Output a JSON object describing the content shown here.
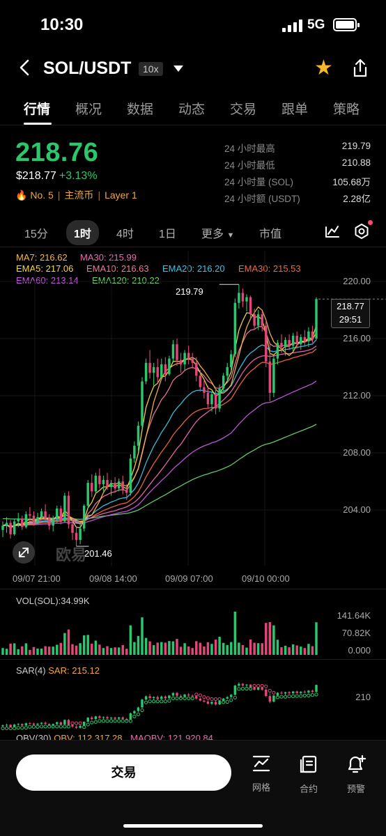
{
  "status_bar": {
    "time": "10:30",
    "network": "5G"
  },
  "header": {
    "pair": "SOL/USDT",
    "leverage": "10x"
  },
  "tabs": [
    "行情",
    "概况",
    "数据",
    "动态",
    "交易",
    "跟单",
    "策略"
  ],
  "ticker": {
    "last_price": "218.76",
    "usd_price": "$218.77",
    "change_pct": "+3.13%",
    "rank": "No. 5",
    "tag1": "主流币",
    "tag2": "Layer 1",
    "stats": [
      {
        "label": "24 小时最高",
        "value": "219.79"
      },
      {
        "label": "24 小时最低",
        "value": "210.88"
      },
      {
        "label": "24 小时量 (SOL)",
        "value": "105.68万"
      },
      {
        "label": "24 小时额 (USDT)",
        "value": "2.28亿"
      }
    ]
  },
  "intervals": {
    "i15": "15分",
    "i1h": "1时",
    "i4h": "4时",
    "i1d": "1日",
    "more": "更多",
    "mcap": "市值"
  },
  "indicators": {
    "ma7": "MA7: 216.62",
    "ma30": "MA30: 215.99",
    "ema5": "EMA5: 217.06",
    "ema10": "EMA10: 216.63",
    "ema20": "EMA20: 216.20",
    "ema30": "EMA30: 215.53",
    "ema60": "EMA60: 213.14",
    "ema120": "EMA120: 210.22"
  },
  "colors": {
    "up": "#2bc76e",
    "down": "#e0487a",
    "ma7": "#f5b84a",
    "ma30": "#ec6bb0",
    "ema5": "#f7d94c",
    "ema10": "#f07a9a",
    "ema20": "#3ec4e6",
    "ema30": "#f06a3a",
    "ema60": "#c55be0",
    "ema120": "#6cd36a"
  },
  "chart_data": {
    "type": "candlestick",
    "y_ticks": [
      "220.00",
      "216.00",
      "212.00",
      "208.00",
      "204.00"
    ],
    "ylim": [
      200.2,
      221.0
    ],
    "x_ticks": [
      "09/07 21:00",
      "09/08 14:00",
      "09/09 07:00",
      "09/10 00:00"
    ],
    "high_label": "219.79",
    "low_label": "201.46",
    "last_price_tag": "218.77",
    "countdown": "29:51",
    "ohlc": [
      [
        202.6,
        203.2,
        202.1,
        202.9
      ],
      [
        202.9,
        203.5,
        202.4,
        203.1
      ],
      [
        203.1,
        203.3,
        202.0,
        202.3
      ],
      [
        202.3,
        203.4,
        202.2,
        203.2
      ],
      [
        203.2,
        203.8,
        202.8,
        203.4
      ],
      [
        203.4,
        203.6,
        202.6,
        202.8
      ],
      [
        202.8,
        203.9,
        202.7,
        203.7
      ],
      [
        203.7,
        204.2,
        203.2,
        203.6
      ],
      [
        203.6,
        203.9,
        202.9,
        203.1
      ],
      [
        203.1,
        203.8,
        203.0,
        203.5
      ],
      [
        203.5,
        204.1,
        203.3,
        203.9
      ],
      [
        203.9,
        204.4,
        203.2,
        203.4
      ],
      [
        203.4,
        203.7,
        202.6,
        202.9
      ],
      [
        202.9,
        203.6,
        202.5,
        203.4
      ],
      [
        203.4,
        204.3,
        203.1,
        204.1
      ],
      [
        204.1,
        204.3,
        203.0,
        203.2
      ],
      [
        203.2,
        205.2,
        203.1,
        205.0
      ],
      [
        205.0,
        205.3,
        202.7,
        203.0
      ],
      [
        203.0,
        203.4,
        201.9,
        202.4
      ],
      [
        202.4,
        202.8,
        201.46,
        201.9
      ],
      [
        201.9,
        203.0,
        201.6,
        202.7
      ],
      [
        202.7,
        204.4,
        202.5,
        204.3
      ],
      [
        204.3,
        206.1,
        204.1,
        205.9
      ],
      [
        205.9,
        206.5,
        204.9,
        205.3
      ],
      [
        205.3,
        206.6,
        205.1,
        206.4
      ],
      [
        206.4,
        206.9,
        205.5,
        205.8
      ],
      [
        205.8,
        206.4,
        205.3,
        206.1
      ],
      [
        206.1,
        206.6,
        205.4,
        205.6
      ],
      [
        205.6,
        206.1,
        205.0,
        205.9
      ],
      [
        205.9,
        206.3,
        205.2,
        205.5
      ],
      [
        205.5,
        206.2,
        205.3,
        206.0
      ],
      [
        206.0,
        206.4,
        205.1,
        205.4
      ],
      [
        205.4,
        205.8,
        204.7,
        205.2
      ],
      [
        205.2,
        207.9,
        205.0,
        207.6
      ],
      [
        207.6,
        208.8,
        207.3,
        208.5
      ],
      [
        208.5,
        210.2,
        208.1,
        209.9
      ],
      [
        209.9,
        213.3,
        209.7,
        213.0
      ],
      [
        213.0,
        214.6,
        212.8,
        214.3
      ],
      [
        214.3,
        215.2,
        213.2,
        213.6
      ],
      [
        213.6,
        214.3,
        212.7,
        214.0
      ],
      [
        214.0,
        214.6,
        212.9,
        213.3
      ],
      [
        213.3,
        214.6,
        213.1,
        214.2
      ],
      [
        214.2,
        214.7,
        213.0,
        213.5
      ],
      [
        213.5,
        214.8,
        213.4,
        214.6
      ],
      [
        214.6,
        215.9,
        214.4,
        215.6
      ],
      [
        215.6,
        216.0,
        214.1,
        214.5
      ],
      [
        214.5,
        215.0,
        213.6,
        214.2
      ],
      [
        214.2,
        215.2,
        213.8,
        215.0
      ],
      [
        215.0,
        215.5,
        214.2,
        214.6
      ],
      [
        214.6,
        215.0,
        213.9,
        214.3
      ],
      [
        214.3,
        214.7,
        213.0,
        213.4
      ],
      [
        213.4,
        213.8,
        212.3,
        212.6
      ],
      [
        212.6,
        213.1,
        211.8,
        212.2
      ],
      [
        212.2,
        212.7,
        211.1,
        211.4
      ],
      [
        211.4,
        212.3,
        210.9,
        212.1
      ],
      [
        212.1,
        212.6,
        210.7,
        211.1
      ],
      [
        211.1,
        212.8,
        210.88,
        212.5
      ],
      [
        212.5,
        213.6,
        212.3,
        213.4
      ],
      [
        213.4,
        214.3,
        213.0,
        214.0
      ],
      [
        214.0,
        215.2,
        213.7,
        214.9
      ],
      [
        214.9,
        218.8,
        214.7,
        218.5
      ],
      [
        218.5,
        219.79,
        218.1,
        219.2
      ],
      [
        219.2,
        219.5,
        218.2,
        218.6
      ],
      [
        218.6,
        219.1,
        217.9,
        218.9
      ],
      [
        218.9,
        219.0,
        217.4,
        217.7
      ],
      [
        217.7,
        218.1,
        216.6,
        216.9
      ],
      [
        216.9,
        218.0,
        216.6,
        217.7
      ],
      [
        217.7,
        217.9,
        216.5,
        216.9
      ],
      [
        216.9,
        217.3,
        214.0,
        214.4
      ],
      [
        214.4,
        215.6,
        211.6,
        212.2
      ],
      [
        212.2,
        214.8,
        211.9,
        214.6
      ],
      [
        214.6,
        215.9,
        214.2,
        215.7
      ],
      [
        215.7,
        216.3,
        215.0,
        215.4
      ],
      [
        215.4,
        216.1,
        214.8,
        215.9
      ],
      [
        215.9,
        216.3,
        215.2,
        215.5
      ],
      [
        215.5,
        216.4,
        215.1,
        216.2
      ],
      [
        216.2,
        216.5,
        215.3,
        215.6
      ],
      [
        215.6,
        216.3,
        215.2,
        216.1
      ],
      [
        216.1,
        216.6,
        215.5,
        215.8
      ],
      [
        215.8,
        216.8,
        215.4,
        216.5
      ],
      [
        216.5,
        216.9,
        215.7,
        216.0
      ],
      [
        216.0,
        218.9,
        215.9,
        218.77
      ]
    ],
    "volume_axis": [
      "141.64K",
      "70.82K",
      "0.000"
    ],
    "volume_label": "VOL(SOL):34.99K",
    "sar_label_name": "SAR(4)",
    "sar_label_value": "SAR: 215.12",
    "sar_axis": "210",
    "obv_label": "OBV(30)",
    "obv_value": "OBV: 112,317.28",
    "maobv_value": "MAOBV: 121,920.84"
  },
  "watermark": "欧易",
  "bottom_bar": {
    "trade": "交易",
    "grid": "网格",
    "contract": "合约",
    "alert": "预警"
  }
}
